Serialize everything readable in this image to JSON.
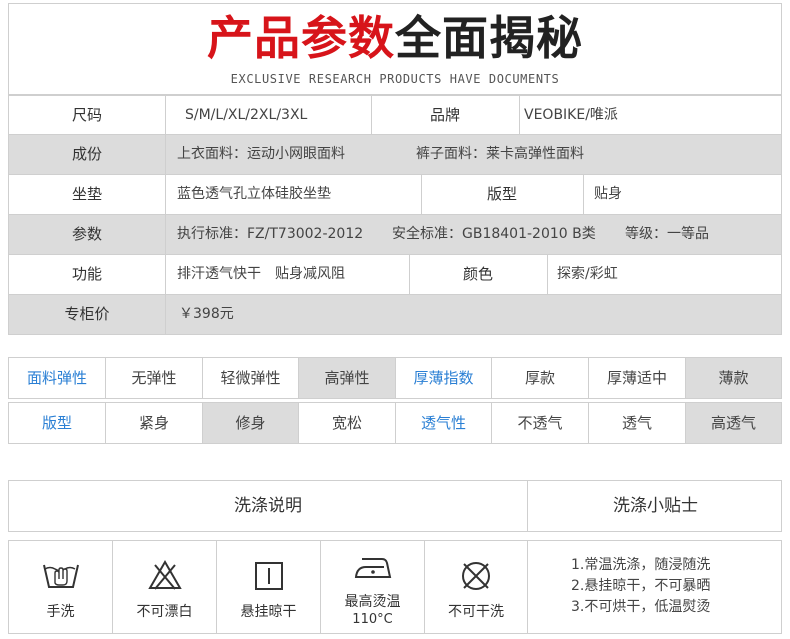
{
  "header": {
    "title_red": "产品参数",
    "title_dark": "全面揭秘",
    "subtitle": "EXCLUSIVE RESEARCH PRODUCTS HAVE DOCUMENTS"
  },
  "spec": {
    "size": {
      "key": "尺码",
      "value": "S/M/L/XL/2XL/3XL",
      "key2": "品牌",
      "value2": "VEOBIKE/唯派"
    },
    "material": {
      "key": "成份",
      "value": "上衣面料：运动小网眼面料",
      "value2": "裤子面料：莱卡高弹性面料"
    },
    "pad": {
      "key": "坐垫",
      "value": "蓝色透气孔立体硅胶坐垫",
      "key2": "版型",
      "value2": "贴身"
    },
    "params": {
      "key": "参数",
      "value": "执行标准：FZ/T73002-2012",
      "value2": "安全标准：GB18401-2010 B类",
      "value3": "等级：一等品"
    },
    "function": {
      "key": "功能",
      "value": "排汗透气快干　贴身减风阻",
      "key2": "颜色",
      "value2": "探索/彩虹"
    },
    "price": {
      "key": "专柜价",
      "value": "￥398元"
    }
  },
  "attributes": {
    "row1": [
      "面料弹性",
      "无弹性",
      "轻微弹性",
      "高弹性",
      "厚薄指数",
      "厚款",
      "厚薄适中",
      "薄款"
    ],
    "row2": [
      "版型",
      "紧身",
      "修身",
      "宽松",
      "透气性",
      "不透气",
      "透气",
      "高透气"
    ]
  },
  "wash": {
    "title": "洗涤说明",
    "tips_title": "洗涤小贴士",
    "icons": [
      {
        "icon": "hand-wash-icon",
        "label": "手洗"
      },
      {
        "icon": "no-bleach-icon",
        "label": "不可漂白"
      },
      {
        "icon": "line-dry-icon",
        "label": "悬挂晾干"
      },
      {
        "icon": "iron-icon",
        "label": "最高烫温",
        "sub": "110°C"
      },
      {
        "icon": "no-dry-clean-icon",
        "label": "不可干洗"
      }
    ],
    "tips": [
      "1.常温洗涤，随浸随洗",
      "2.悬挂晾干，不可暴晒",
      "3.不可烘干，低温熨烫"
    ]
  },
  "colors": {
    "accent_red": "#d7141a",
    "accent_blue": "#2a7fd4",
    "highlight_gray": "#dcdcdc"
  }
}
